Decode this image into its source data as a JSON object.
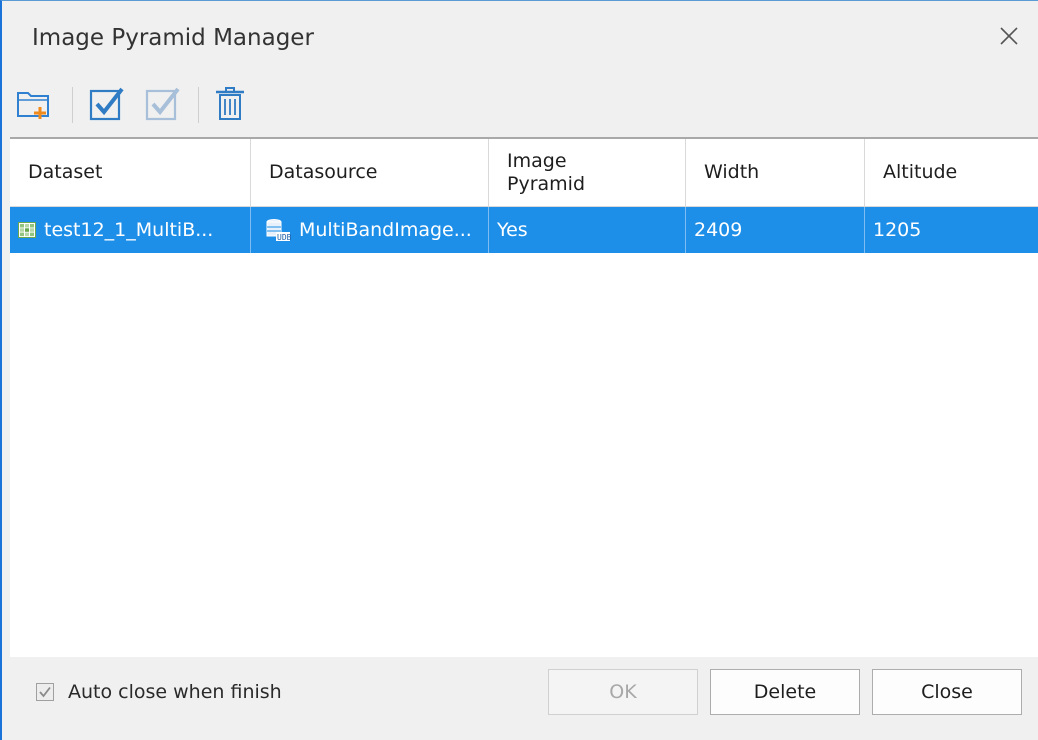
{
  "window": {
    "title": "Image Pyramid Manager"
  },
  "toolbar": {
    "items": [
      {
        "icon": "add-folder-icon"
      },
      {
        "icon": "check-all-icon"
      },
      {
        "icon": "check-inverse-icon"
      },
      {
        "icon": "delete-icon"
      }
    ]
  },
  "table": {
    "columns": [
      "Dataset",
      "Datasource",
      "Image\nPyramid",
      "Width",
      "Altitude"
    ],
    "rows": [
      {
        "dataset": "test12_1_MultiB...",
        "datasource": "MultiBandImage...",
        "pyramid": "Yes",
        "width": "2409",
        "altitude": "1205",
        "selected": true
      }
    ]
  },
  "footer": {
    "auto_close_label": "Auto close when finish",
    "auto_close_checked": true,
    "ok_label": "OK",
    "delete_label": "Delete",
    "close_label": "Close"
  },
  "colors": {
    "selection": "#1e8fe8",
    "accent": "#1a73d9"
  }
}
